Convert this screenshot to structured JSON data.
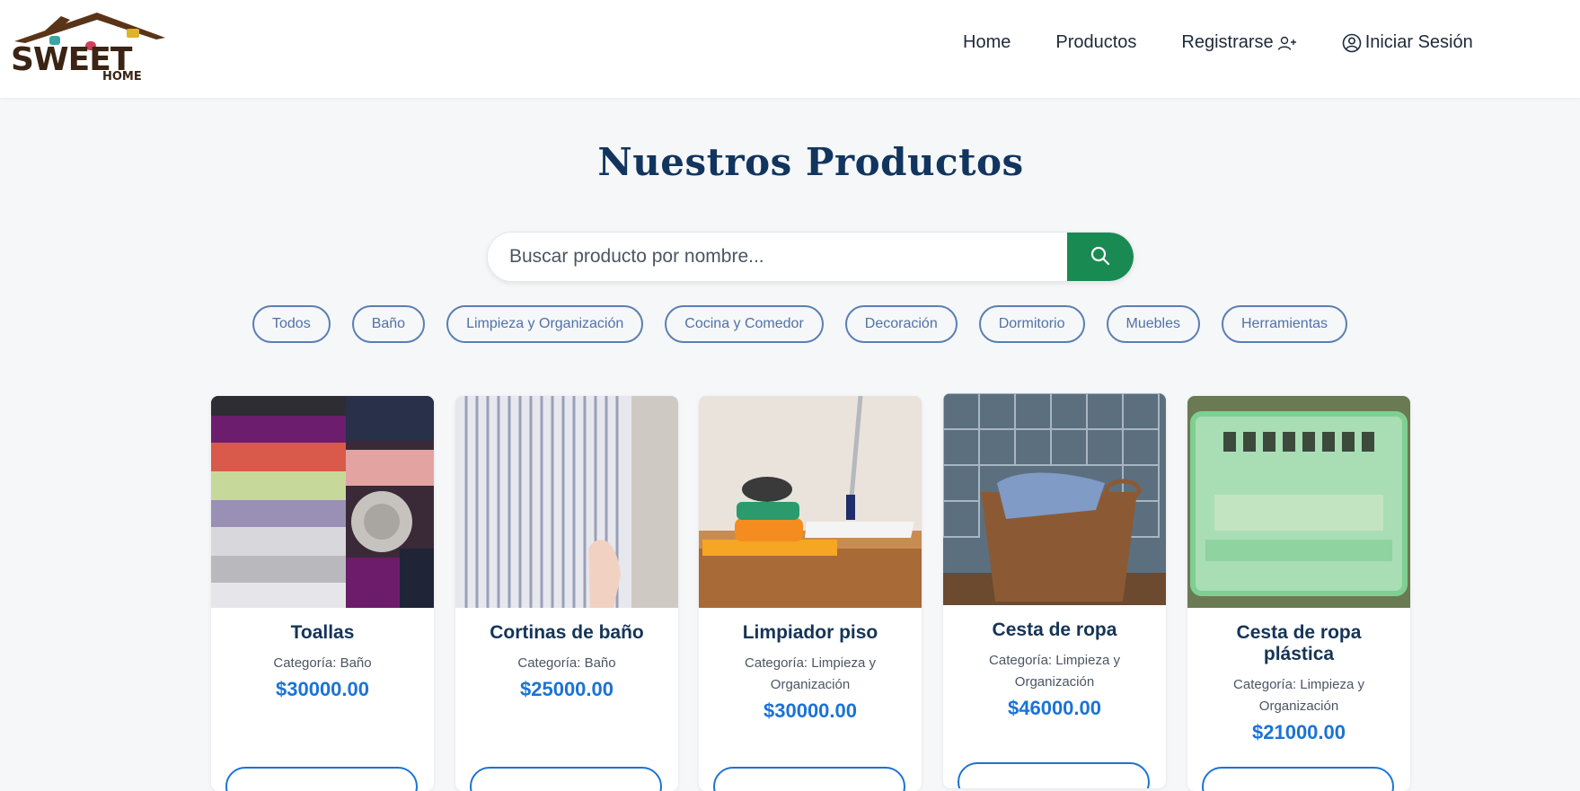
{
  "brand": {
    "logo_line1": "SWEET",
    "logo_line2": "HOME",
    "colors": {
      "roof": "#5a3418",
      "text": "#3b2414",
      "window_teal": "#3aa6a0",
      "window_red": "#d0415a",
      "window_yellow": "#e0b12a"
    }
  },
  "nav": {
    "links": [
      {
        "label": "Home"
      },
      {
        "label": "Productos"
      },
      {
        "label": "Registrarse",
        "icon": "user-plus-icon"
      },
      {
        "label": "Iniciar Sesión",
        "icon": "user-circle-icon"
      }
    ]
  },
  "main": {
    "title": "Nuestros Productos",
    "search": {
      "placeholder": "Buscar producto por nombre...",
      "value": "",
      "button_icon": "search-icon"
    }
  },
  "filters": [
    "Todos",
    "Baño",
    "Limpieza y Organización",
    "Cocina y Comedor",
    "Decoración",
    "Dormitorio",
    "Muebles",
    "Herramientas"
  ],
  "products": [
    {
      "name": "Toallas",
      "category": "Categoría: Baño",
      "price": "$30000.00",
      "image": "towels-image"
    },
    {
      "name": "Cortinas de baño",
      "category": "Categoría: Baño",
      "price": "$25000.00",
      "image": "shower-curtain-image"
    },
    {
      "name": "Limpiador piso",
      "category": "Categoría: Limpieza y Organización",
      "price": "$30000.00",
      "image": "mop-image"
    },
    {
      "name": "Cesta de ropa",
      "category": "Categoría: Limpieza y Organización",
      "price": "$46000.00",
      "image": "wicker-basket-image"
    },
    {
      "name": "Cesta de ropa plástica",
      "category": "Categoría: Limpieza y Organización",
      "price": "$21000.00",
      "image": "plastic-basket-image"
    }
  ],
  "colors": {
    "accent_green": "#1a8a53",
    "price_blue": "#1a73d6",
    "title_navy": "#11355f",
    "filter_border": "#5a7fb3"
  }
}
